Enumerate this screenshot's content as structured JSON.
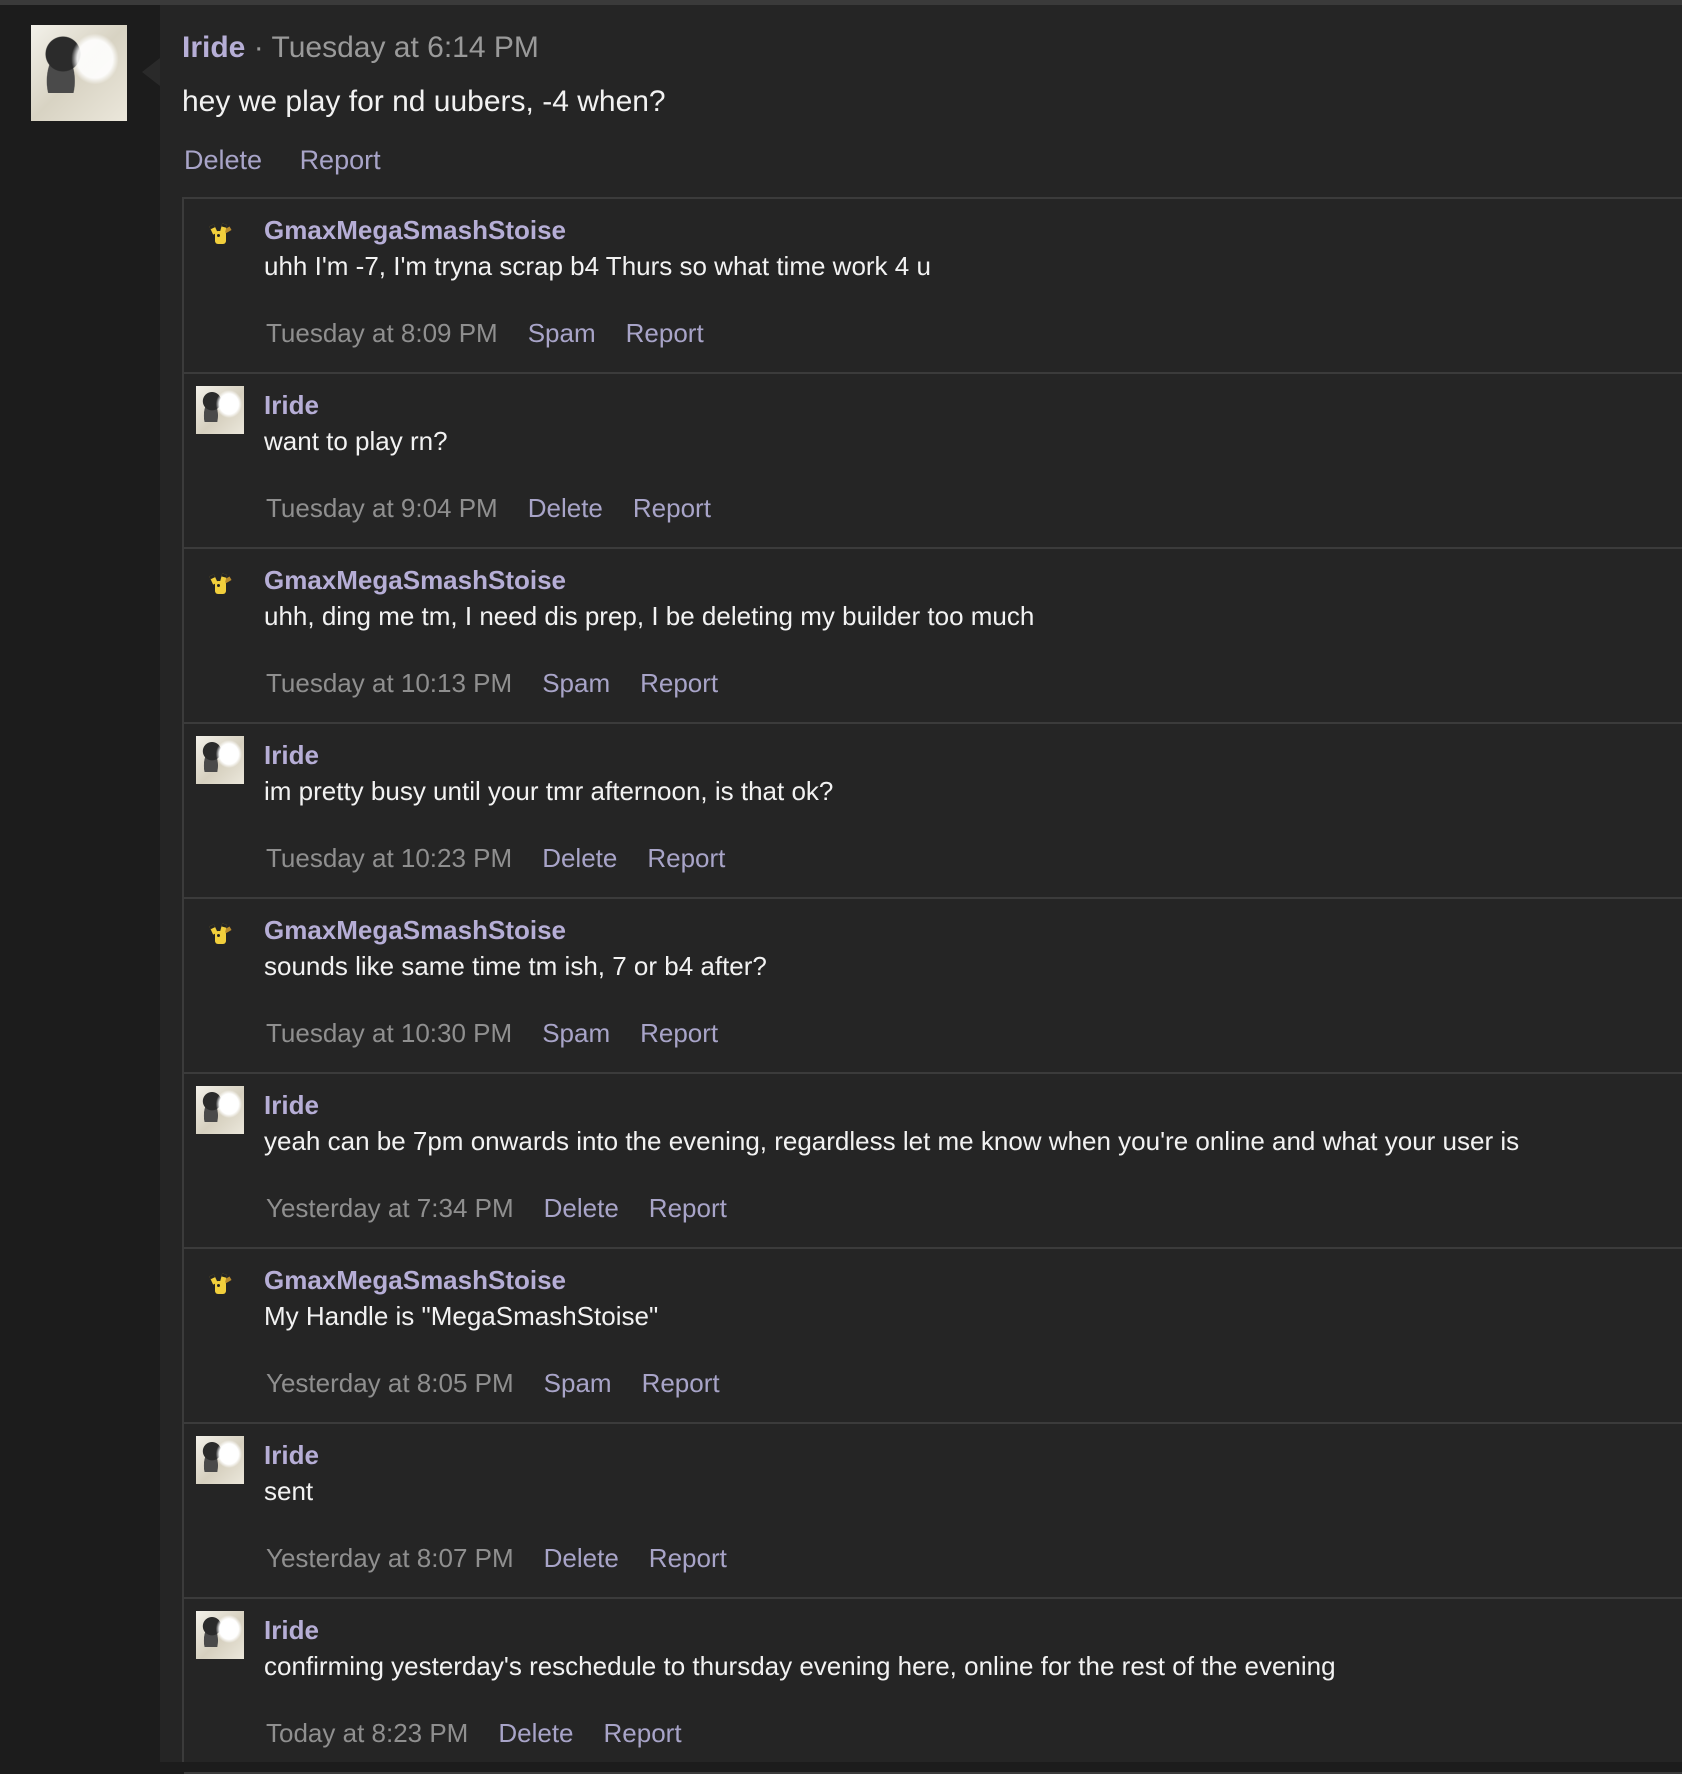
{
  "thread": {
    "author": "Iride",
    "separator": "·",
    "timestamp": "Tuesday at 6:14 PM",
    "message": "hey we play for nd uubers, -4 when?",
    "actions": [
      "Delete",
      "Report"
    ]
  },
  "replies": [
    {
      "author": "GmaxMegaSmashStoise",
      "avatar": "pikachu-sprite-icon",
      "message": "uhh I'm -7, I'm tryna scrap b4 Thurs so what time work 4 u",
      "timestamp": "Tuesday at 8:09 PM",
      "actions": [
        "Spam",
        "Report"
      ]
    },
    {
      "author": "Iride",
      "avatar": "photo-avatar",
      "message": "want to play rn?",
      "timestamp": "Tuesday at 9:04 PM",
      "actions": [
        "Delete",
        "Report"
      ]
    },
    {
      "author": "GmaxMegaSmashStoise",
      "avatar": "pikachu-sprite-icon",
      "message": "uhh, ding me tm, I need dis prep, I be deleting my builder too much",
      "timestamp": "Tuesday at 10:13 PM",
      "actions": [
        "Spam",
        "Report"
      ]
    },
    {
      "author": "Iride",
      "avatar": "photo-avatar",
      "message": "im pretty busy until your tmr afternoon, is that ok?",
      "timestamp": "Tuesday at 10:23 PM",
      "actions": [
        "Delete",
        "Report"
      ]
    },
    {
      "author": "GmaxMegaSmashStoise",
      "avatar": "pikachu-sprite-icon",
      "message": "sounds like same time tm ish, 7 or b4 after?",
      "timestamp": "Tuesday at 10:30 PM",
      "actions": [
        "Spam",
        "Report"
      ]
    },
    {
      "author": "Iride",
      "avatar": "photo-avatar",
      "message": "yeah can be 7pm onwards into the evening, regardless let me know when you're online and what your user is",
      "timestamp": "Yesterday at 7:34 PM",
      "actions": [
        "Delete",
        "Report"
      ]
    },
    {
      "author": "GmaxMegaSmashStoise",
      "avatar": "pikachu-sprite-icon",
      "message": "My Handle is \"MegaSmashStoise\"",
      "timestamp": "Yesterday at 8:05 PM",
      "actions": [
        "Spam",
        "Report"
      ]
    },
    {
      "author": "Iride",
      "avatar": "photo-avatar",
      "message": "sent",
      "timestamp": "Yesterday at 8:07 PM",
      "actions": [
        "Delete",
        "Report"
      ]
    },
    {
      "author": "Iride",
      "avatar": "photo-avatar",
      "message": "confirming yesterday's reschedule to thursday evening here, online for the rest of the evening",
      "timestamp": "Today at 8:23 PM",
      "actions": [
        "Delete",
        "Report"
      ]
    }
  ],
  "colors": {
    "background": "#1c1c1c",
    "panel": "#252525",
    "username": "#b6aed6",
    "link": "#a8a4c8",
    "timestamp": "#8f8f8f",
    "message": "#f2f2f2",
    "divider": "#3b3b3b"
  }
}
